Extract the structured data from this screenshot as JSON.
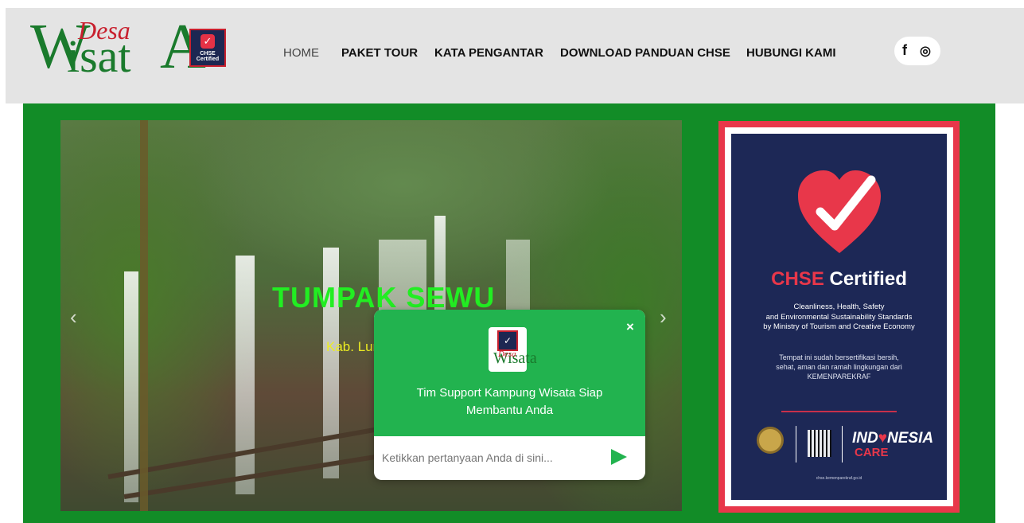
{
  "logo": {
    "text_w": "W",
    "text_isat": "isat",
    "text_a": "A",
    "text_desa": "Desa",
    "badge_icon": "heart-check-icon",
    "badge_text": "CHSE Certified"
  },
  "nav": {
    "items": [
      {
        "label": "HOME",
        "active": true
      },
      {
        "label": "PAKET TOUR",
        "active": false
      },
      {
        "label": "KATA PENGANTAR",
        "active": false
      },
      {
        "label": "DOWNLOAD PANDUAN CHSE",
        "active": false
      },
      {
        "label": "HUBUNGI KAMI",
        "active": false
      }
    ]
  },
  "social": {
    "facebook_glyph": "f",
    "instagram_glyph": "◎",
    "icons": [
      "facebook-icon",
      "instagram-icon"
    ]
  },
  "slider": {
    "title": "TUMPAK SEWU",
    "subtitle": "Kab. Lumajang",
    "prev_glyph": "‹",
    "next_glyph": "›"
  },
  "certificate": {
    "title_part1": "CHSE",
    "title_part2": "Certified",
    "desc_lines": [
      "Cleanliness, Health, Safety",
      "and Environmental Sustainability Standards",
      "by Ministry of Tourism and Creative Economy"
    ],
    "note_lines": [
      "Tempat ini sudah bersertifikasi bersih,",
      "sehat, aman dan ramah lingkungan dari",
      "KEMENPAREKRAF"
    ],
    "brand_part1": "IND",
    "brand_heart": "♥",
    "brand_part2": "NESIA",
    "brand_care": "CARE",
    "url": "chse.kemenparekraf.go.id"
  },
  "chat": {
    "close_glyph": "×",
    "message": "Tim Support Kampung Wisata Siap Membantu Anda",
    "input_placeholder": "Ketikkan pertanyaan Anda di sini...",
    "send_icon": "send-icon",
    "logo_text": "Wisata",
    "logo_desa": "Desa"
  },
  "colors": {
    "brand_green": "#128c27",
    "chat_green": "#22b34f",
    "cert_red": "#e8374a",
    "cert_navy": "#1d2856",
    "title_green": "#22ee22",
    "subtitle_yellow": "#eded22"
  }
}
